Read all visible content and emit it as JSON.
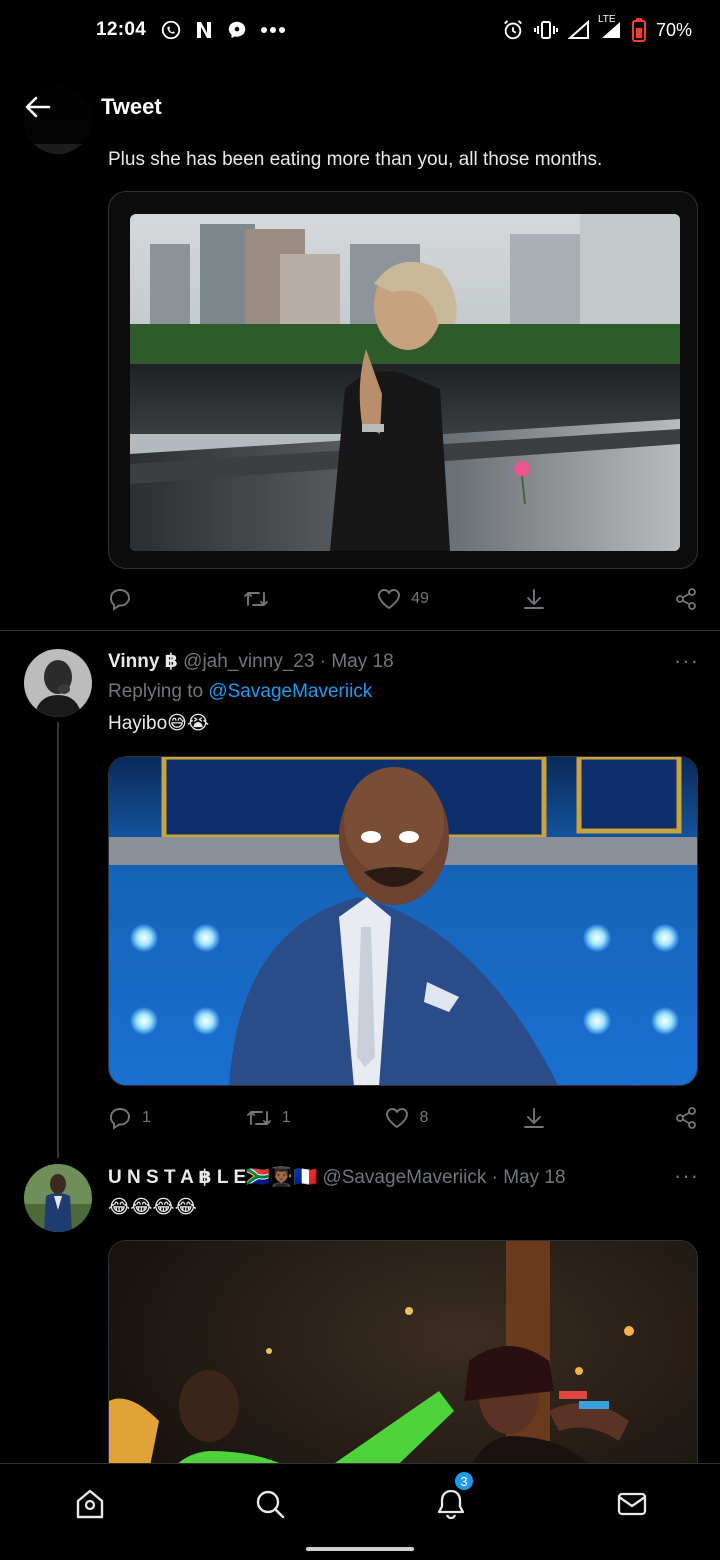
{
  "status_bar": {
    "time": "12:04",
    "left_icons": [
      "whatsapp-icon",
      "netflix-icon",
      "messenger-icon",
      "more-dots-icon"
    ],
    "right_icons": [
      "alarm-icon",
      "vibrate-icon",
      "signal-icon",
      "lte-signal-icon",
      "battery-icon"
    ],
    "lte_label": "LTE",
    "battery": "70%"
  },
  "header": {
    "title": "Tweet"
  },
  "tweet1": {
    "text": "Plus she has been eating more than you, all those months.",
    "actions": {
      "reply": "",
      "retweet": "",
      "like": "49"
    }
  },
  "tweet2": {
    "name": "Vinny ฿",
    "handle": "@jah_vinny_23",
    "date": "· May 18",
    "more": "···",
    "replying_prefix": "Replying to ",
    "replying_to": "@SavageMaveriick",
    "text": "Hayibo😅😭",
    "actions": {
      "reply": "1",
      "retweet": "1",
      "like": "8"
    }
  },
  "tweet3": {
    "name": "U N S T A ฿ L E🇿🇦👨🏾‍🎓🇫🇷",
    "handle": "@SavageMaveriick",
    "date": "· May 18",
    "more": "···",
    "text": "😂😂😂😂"
  },
  "nav": {
    "items": [
      "home-icon",
      "search-icon",
      "notifications-icon",
      "messages-icon"
    ],
    "notification_count": "3"
  },
  "colors": {
    "accent": "#1d9bf0",
    "muted": "#71767b",
    "border": "#2f3336",
    "background": "#000000"
  }
}
